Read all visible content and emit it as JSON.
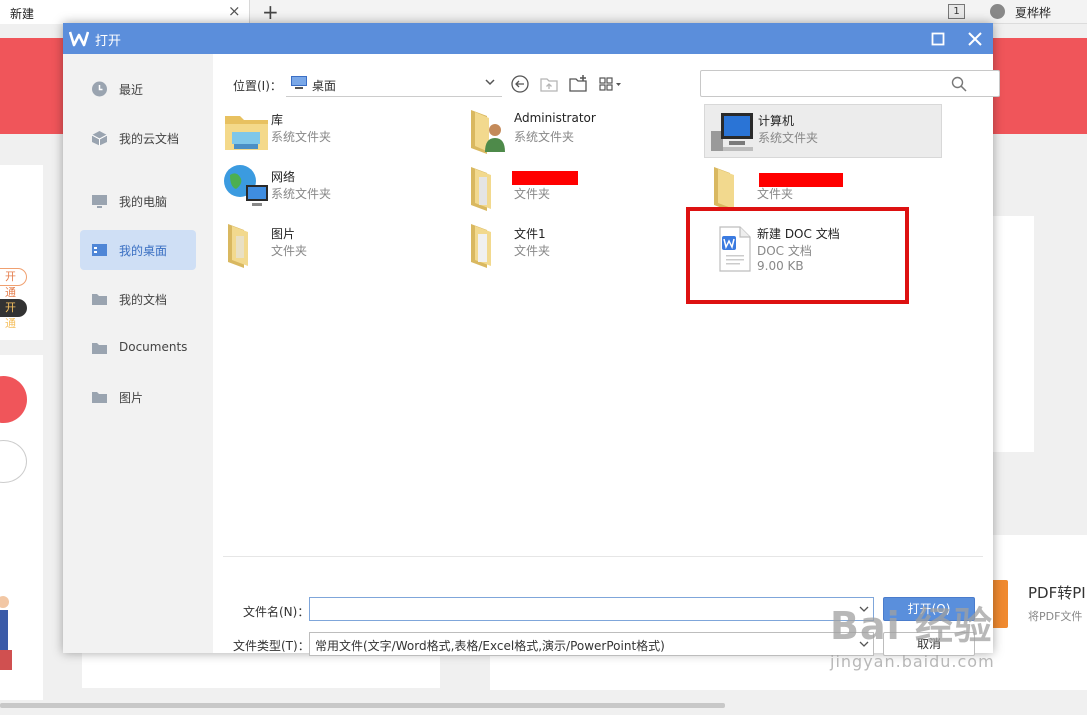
{
  "app": {
    "tab_title": "新建",
    "tab_close": "×",
    "new_tab": "+",
    "window_count": "1",
    "user_name": "夏桦桦",
    "pill_a": "开通",
    "pill_b": "开通",
    "pdf_card_title": "PDF转PI",
    "pdf_card_sub": "将PDF文件"
  },
  "dialog": {
    "title": "打开",
    "location_label": "位置(I)：",
    "location_value": "桌面",
    "search_placeholder": ""
  },
  "sidebar": {
    "items": [
      {
        "label": "最近",
        "icon": "clock-icon"
      },
      {
        "label": "我的云文档",
        "icon": "cloud-box-icon"
      },
      {
        "label": "我的电脑",
        "icon": "computer-icon"
      },
      {
        "label": "我的桌面",
        "icon": "desktop-icon",
        "active": true
      },
      {
        "label": "我的文档",
        "icon": "folder-icon"
      },
      {
        "label": "Documents",
        "icon": "folder-icon"
      },
      {
        "label": "图片",
        "icon": "folder-icon"
      }
    ]
  },
  "files": [
    {
      "name": "库",
      "type": "系统文件夹",
      "icon": "library-folder-icon"
    },
    {
      "name": "Administrator",
      "type": "系统文件夹",
      "icon": "user-folder-icon"
    },
    {
      "name": "计算机",
      "type": "系统文件夹",
      "icon": "computer-icon",
      "selected": true
    },
    {
      "name": "网络",
      "type": "系统文件夹",
      "icon": "network-icon"
    },
    {
      "name": "",
      "type": "文件夹",
      "icon": "folder-icon",
      "redacted": true
    },
    {
      "name": "",
      "type": "文件夹",
      "icon": "folder-icon",
      "redacted": true
    },
    {
      "name": "图片",
      "type": "文件夹",
      "icon": "folder-icon"
    },
    {
      "name": "文件1",
      "type": "文件夹",
      "icon": "folder-icon"
    },
    {
      "name": "新建 DOC 文档",
      "type": "DOC 文档",
      "size": "9.00 KB",
      "icon": "wps-doc-icon"
    }
  ],
  "form": {
    "filename_label": "文件名(N)：",
    "filename_value": "",
    "filetype_label": "文件类型(T)：",
    "filetype_value": "常用文件(文字/Word格式,表格/Excel格式,演示/PowerPoint格式)",
    "open_button": "打开(O)",
    "cancel_button": "取消"
  },
  "watermark": {
    "main": "Bai 经验",
    "sub": "jingyan.baidu.com"
  },
  "colors": {
    "titlebar": "#5b8edb",
    "accent": "#5a8fdc",
    "highlight": "#dd1111",
    "banner": "#f0555a"
  }
}
